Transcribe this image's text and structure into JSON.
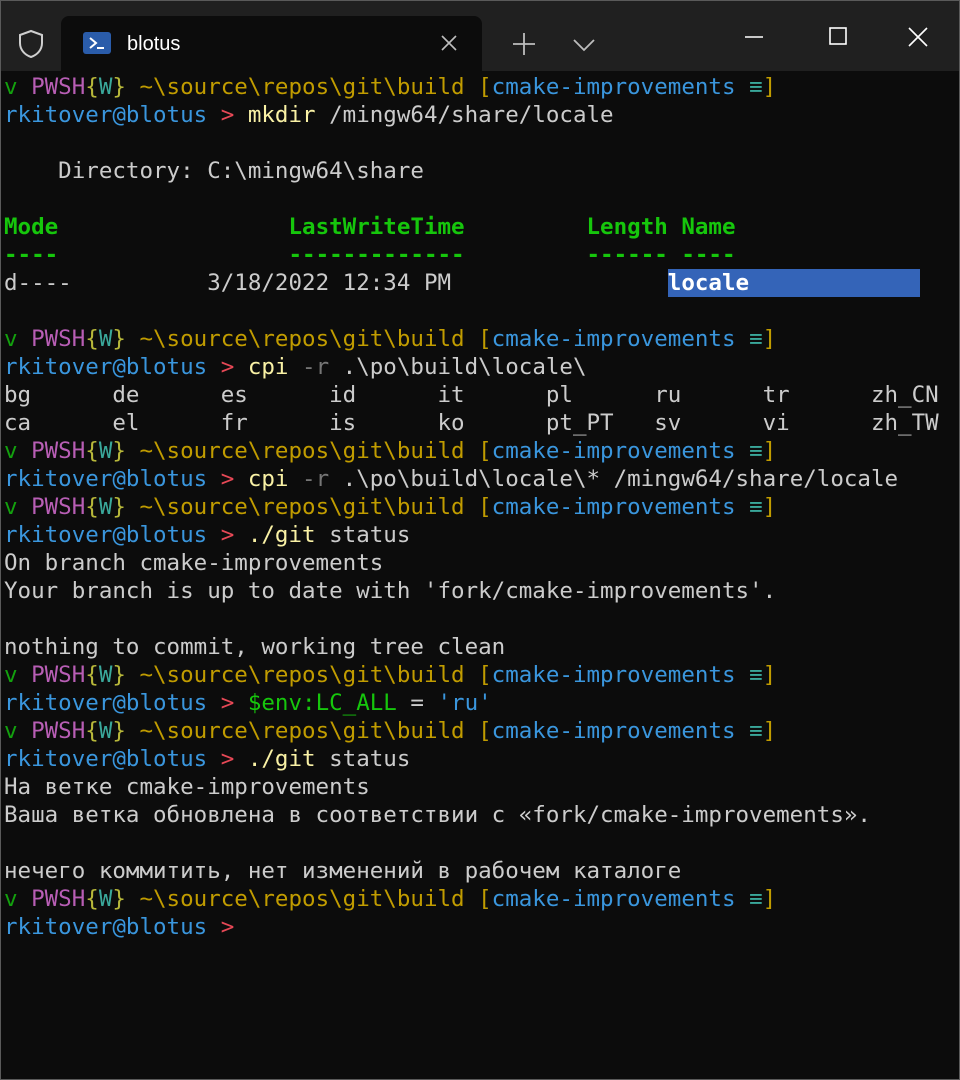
{
  "window": {
    "tab_title": "blotus",
    "icons": [
      "shield-icon",
      "powershell-icon",
      "close-tab-icon",
      "new-tab-icon",
      "dropdown-icon",
      "minimize-icon",
      "maximize-icon",
      "close-window-icon"
    ]
  },
  "prompt": {
    "v": "v",
    "shell": "PWSH",
    "brace_open": "{",
    "w": "W",
    "brace_close": "}",
    "path": "~\\source\\repos\\git\\build",
    "bracket_open": "[",
    "branch": "cmake-improvements",
    "status": "≡",
    "bracket_close": "]",
    "user": "rkitover@blotus",
    "arrow": ">"
  },
  "lines": {
    "cmd1_name": "mkdir",
    "cmd1_args": "/mingw64/share/locale",
    "dir_label": "    Directory: C:\\mingw64\\share",
    "hdr_mode": "Mode",
    "hdr_lwt": "LastWriteTime",
    "hdr_len": "Length",
    "hdr_name": "Name",
    "ul_mode": "----",
    "ul_lwt": "-------------",
    "ul_len": "------",
    "ul_name": "----",
    "row_mode": "d----",
    "row_time": "3/18/2022 12:34 PM",
    "row_name": "locale",
    "cmd2_name": "cpi",
    "cmd2_param": "-r",
    "cmd2_args": ".\\po\\build\\locale\\",
    "ls_row1": "bg      de      es      id      it      pl      ru      tr      zh_CN",
    "ls_row2": "ca      el      fr      is      ko      pt_PT   sv      vi      zh_TW",
    "cmd3_name": "cpi",
    "cmd3_param": "-r",
    "cmd3_args": ".\\po\\build\\locale\\* /mingw64/share/locale",
    "cmd4_name": "./git",
    "cmd4_args": "status",
    "out4_1": "On branch cmake-improvements",
    "out4_2": "Your branch is up to date with 'fork/cmake-improvements'.",
    "out4_3": "nothing to commit, working tree clean",
    "cmd5_var": "$env:LC_ALL",
    "cmd5_eq": "=",
    "cmd5_val": "'ru'",
    "cmd6_name": "./git",
    "cmd6_args": "status",
    "out6_1": "На ветке cmake-improvements",
    "out6_2": "Ваша ветка обновлена в соответствии с «fork/cmake-improvements».",
    "out6_3": "нечего коммитить, нет изменений в рабочем каталоге"
  }
}
